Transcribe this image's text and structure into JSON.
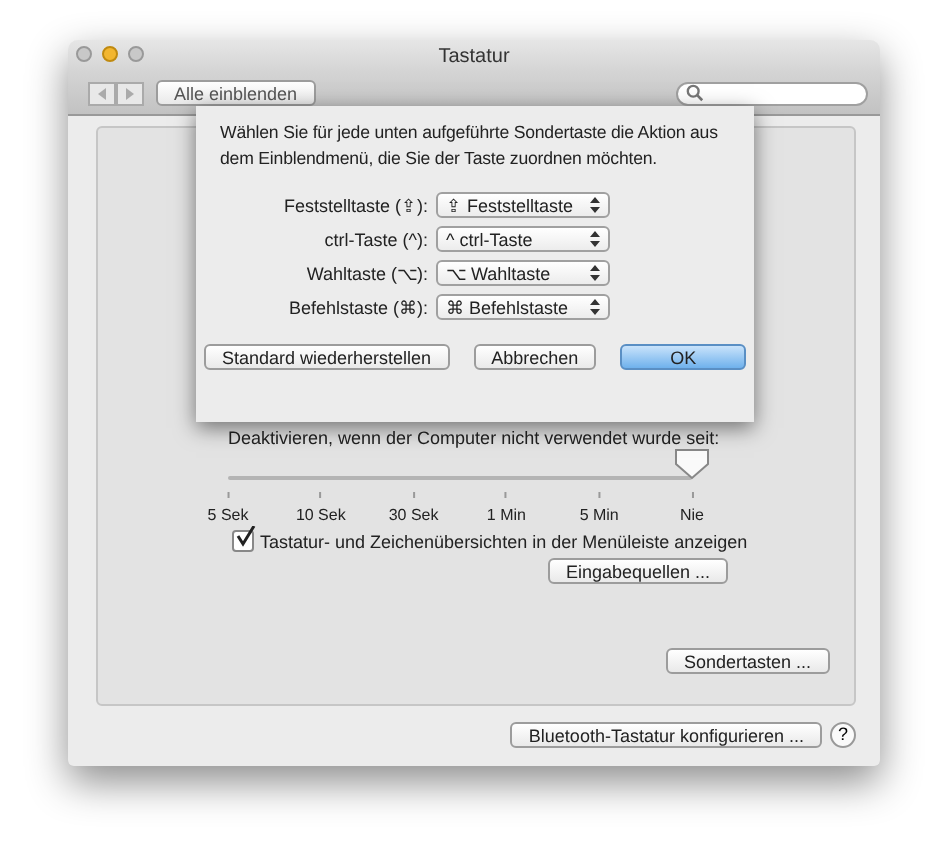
{
  "window": {
    "title": "Tastatur"
  },
  "toolbar": {
    "show_all_button": "Alle einblenden"
  },
  "dialog": {
    "message": "Wählen Sie für jede unten aufgeführte Sondertaste die Aktion aus dem Einblendmenü, die Sie der Taste zuordnen möchten.",
    "rows": [
      {
        "label": "Feststelltaste (⇪):",
        "value": "⇪ Feststelltaste"
      },
      {
        "label": "ctrl-Taste (^):",
        "value": "^ ctrl-Taste"
      },
      {
        "label": "Wahltaste (⌥):",
        "value": "⌥ Wahltaste"
      },
      {
        "label": "Befehlstaste (⌘):",
        "value": "⌘ Befehlstaste"
      }
    ],
    "buttons": [
      {
        "label": "Standard wiederherstellen",
        "default": false
      },
      {
        "label": "Abbrechen",
        "default": false
      },
      {
        "label": "OK",
        "default": true
      }
    ]
  },
  "backlight": {
    "label": "Deaktivieren, wenn der Computer nicht verwendet wurde seit:",
    "slider": {
      "level": 1
    },
    "ticks": [
      "5 Sek",
      "10 Sek",
      "30 Sek",
      "1 Min",
      "5 Min",
      "Nie"
    ]
  },
  "show_viewers": {
    "label": "Tastatur- und Zeichenübersichten in der Menüleiste anzeigen",
    "checked": true
  },
  "input_sources_button": "Eingabequellen ...",
  "modifier_keys_button": "Sondertasten ...",
  "bluetooth_button": "Bluetooth-Tastatur konfigurieren ...",
  "help_button": "?"
}
